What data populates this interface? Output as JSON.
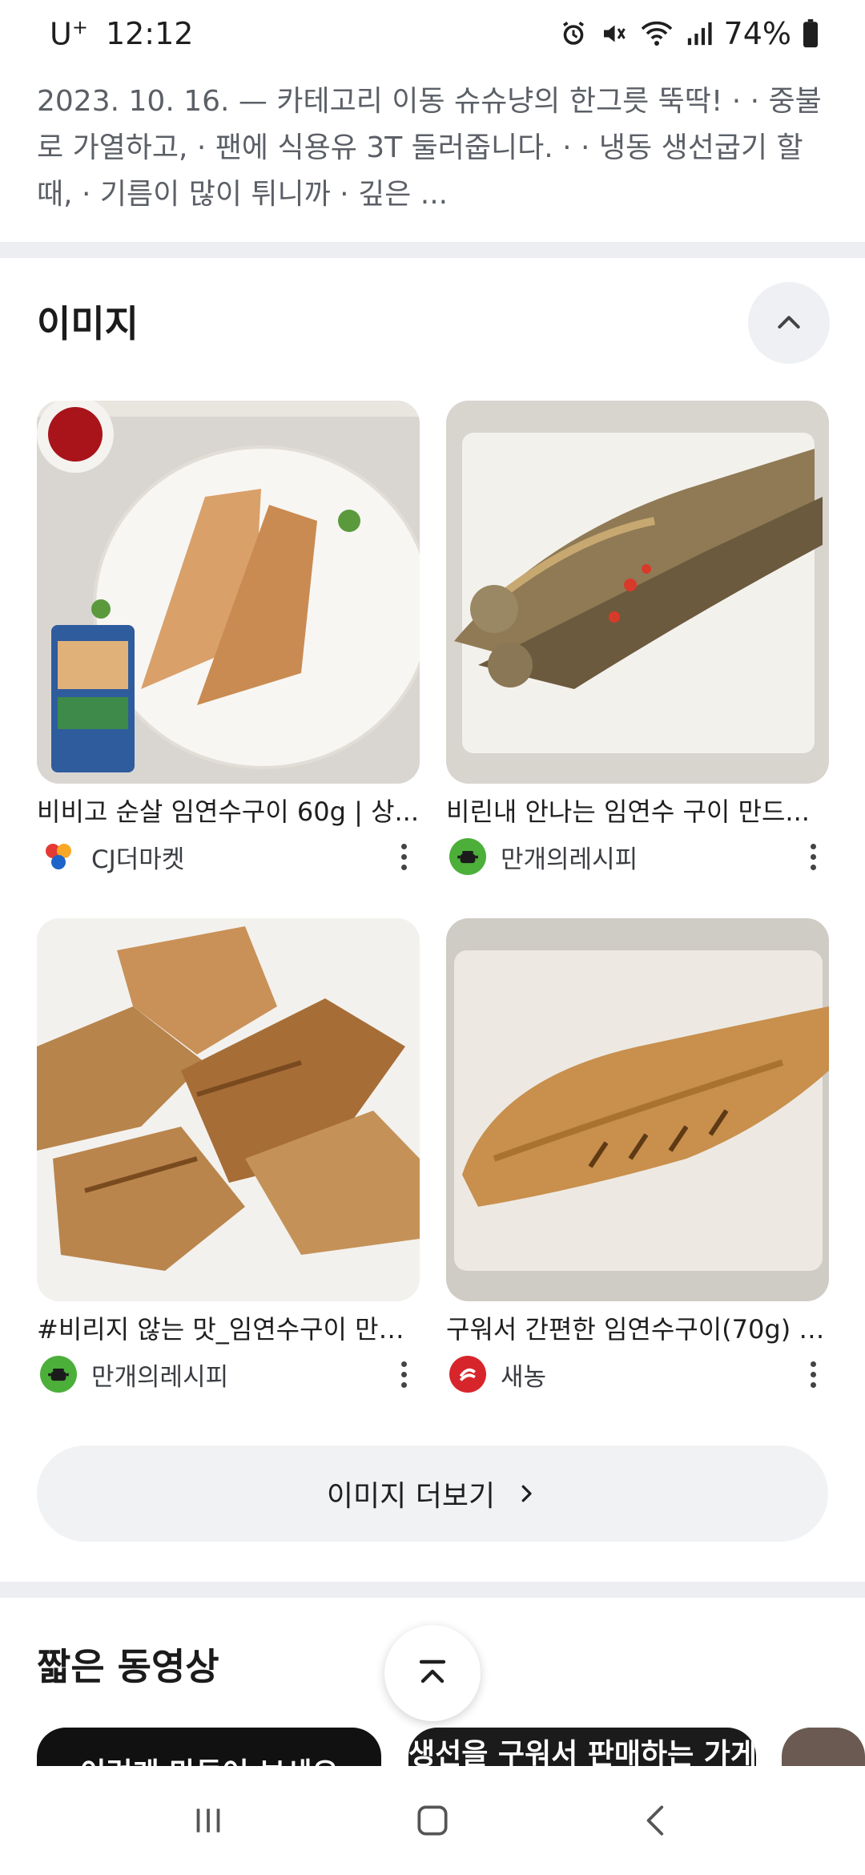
{
  "status_bar": {
    "carrier": "U",
    "carrier_sup": "+",
    "time": "12:12",
    "battery": "74%"
  },
  "snippet": {
    "text": "2023. 10. 16. — 카테고리 이동 슈슈냥의 한그릇 뚝딱! · · 중불로 가열하고, · 팬에 식용유 3T 둘러줍니다. · · 냉동 생선굽기 할 때, · 기름이 많이 튀니까 · 깊은 ..."
  },
  "images_section": {
    "title": "이미지",
    "cards": [
      {
        "title": "비비고 순살 임연수구이 60g | 상...",
        "source": "CJ더마켓"
      },
      {
        "title": "비린내 안나는 임연수 구이 만드...",
        "source": "만개의레시피"
      },
      {
        "title": "#비리지 않는 맛_임연수구이 만들...",
        "source": "만개의레시피"
      },
      {
        "title": "구워서 간편한 임연수구이(70g) -...",
        "source": "새농"
      }
    ],
    "more_label": "이미지 더보기"
  },
  "shorts_section": {
    "title": "짧은 동영상",
    "thumbs": [
      {
        "caption": "이런게 만들어 보세요"
      },
      {
        "caption": "생선을 구워서 판매하는 가게"
      }
    ]
  },
  "colors": {
    "text_primary": "#1f1f1f",
    "snippet_text": "#5b5f66",
    "divider": "#eceef1",
    "pill_bg": "#f1f2f4",
    "source_green": "#4caf3a",
    "source_red": "#d7262b"
  }
}
